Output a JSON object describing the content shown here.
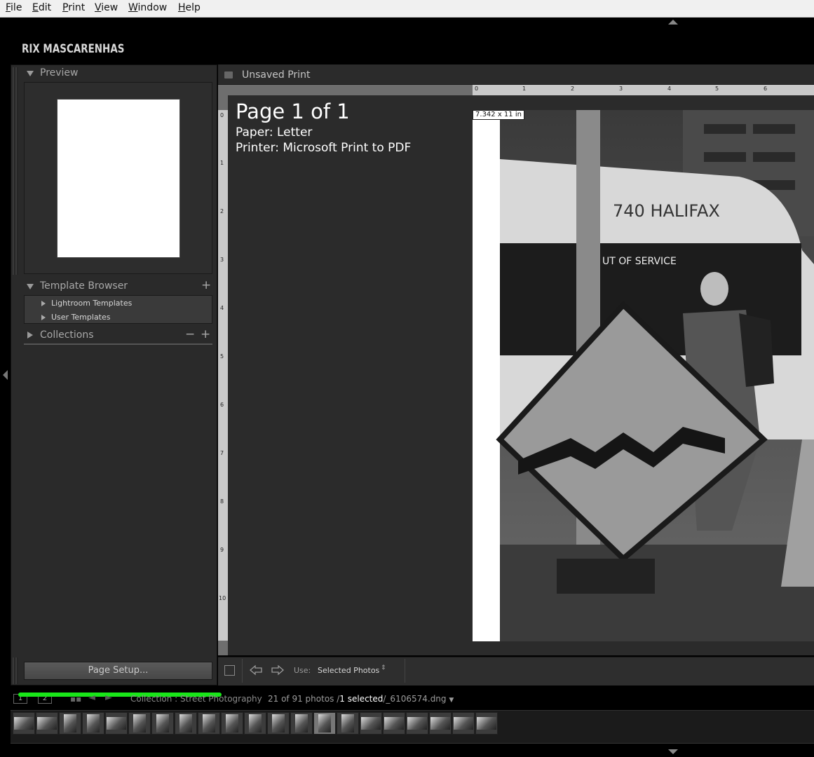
{
  "menu": [
    "File",
    "Edit",
    "Print",
    "View",
    "Window",
    "Help"
  ],
  "brand": "RIX MASCARENHAS",
  "left_panel": {
    "preview_title": "Preview",
    "template_browser_title": "Template Browser",
    "templates": [
      "Lightroom Templates",
      "User Templates"
    ],
    "collections_title": "Collections",
    "page_setup_label": "Page Setup..."
  },
  "main": {
    "title": "Unsaved Print",
    "page_count": "Page 1 of 1",
    "paper": "Paper:  Letter",
    "printer": "Printer:  Microsoft Print to PDF",
    "dimension_label": "7.342 x 11 in",
    "ruler_top": [
      "0",
      "1",
      "2",
      "3",
      "4",
      "5",
      "6"
    ],
    "ruler_left": [
      "0",
      "1",
      "2",
      "3",
      "4",
      "5",
      "6",
      "7",
      "8",
      "9",
      "10"
    ]
  },
  "toolbar": {
    "use_label": "Use:",
    "use_value": "Selected Photos"
  },
  "filmstrip": {
    "pages": [
      "1",
      "2"
    ],
    "collection": "Collection : Street Photography",
    "count_prefix": "21 of 91 photos /",
    "count_selected": "1 selected",
    "count_file": "/_6106574.dng"
  },
  "colors": {
    "accent_green": "#19e619",
    "panel": "#2a2a2a"
  }
}
